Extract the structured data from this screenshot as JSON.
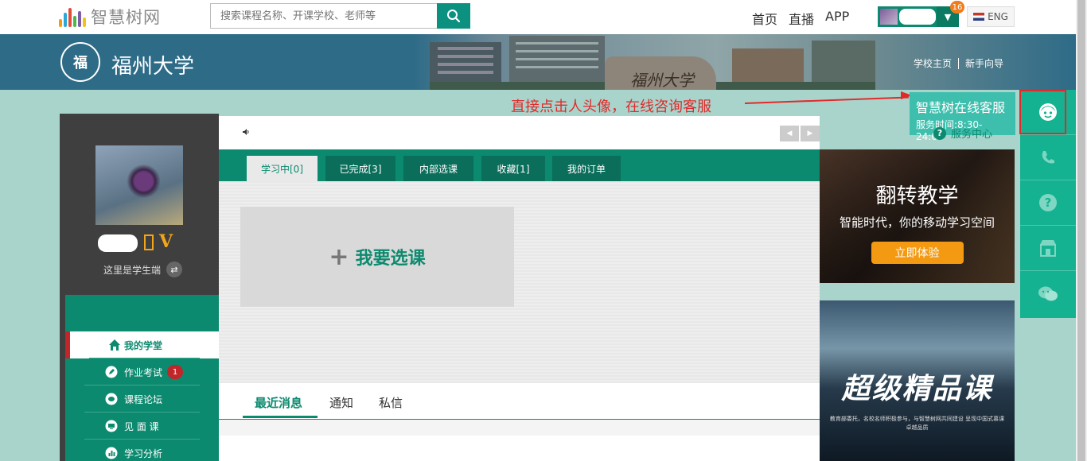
{
  "header": {
    "logo_text": "智慧树网",
    "search_placeholder": "搜索课程名称、开课学校、老师等",
    "nav": [
      "首页",
      "直播",
      "APP"
    ],
    "notification_count": "16",
    "lang_label": "ENG"
  },
  "banner": {
    "university_name": "福州大学",
    "seal_char": "福",
    "rock_text": "福州大学",
    "links": [
      "学校主页",
      "新手向导"
    ]
  },
  "annotation": {
    "text": "直接点击人头像，在线咨询客服"
  },
  "customer_service": {
    "title": "智慧树在线客服",
    "hours": "服务时间:8:30-24:00",
    "help_center": "服务中心"
  },
  "sidebar": {
    "vip_mark": "V",
    "role_text": "这里是学生端",
    "menu": [
      {
        "label": "我的学堂",
        "icon": "home-icon"
      },
      {
        "label": "作业考试",
        "icon": "pencil-icon",
        "badge": "1"
      },
      {
        "label": "课程论坛",
        "icon": "chat-icon"
      },
      {
        "label": "见 面 课",
        "icon": "screen-icon"
      },
      {
        "label": "学习分析",
        "icon": "chart-icon"
      }
    ]
  },
  "main": {
    "tabs": [
      "学习中[0]",
      "已完成[3]",
      "内部选课",
      "收藏[1]",
      "我的订单"
    ],
    "select_course": "我要选课",
    "message_tabs": [
      "最近消息",
      "通知",
      "私信"
    ]
  },
  "ads": {
    "ad1_title": "翻转教学",
    "ad1_sub": "智能时代，你的移动学习空间",
    "ad1_button": "立即体验",
    "ad2_title": "超级精品课",
    "ad2_sub": "教育部委托，名校名师积极参与，与智慧树网共同建设 呈现中国式慕课卓越品质"
  },
  "colors": {
    "brand_green": "#0c8a6f",
    "accent_red": "#e12a2a",
    "accent_orange": "#f39a12"
  }
}
